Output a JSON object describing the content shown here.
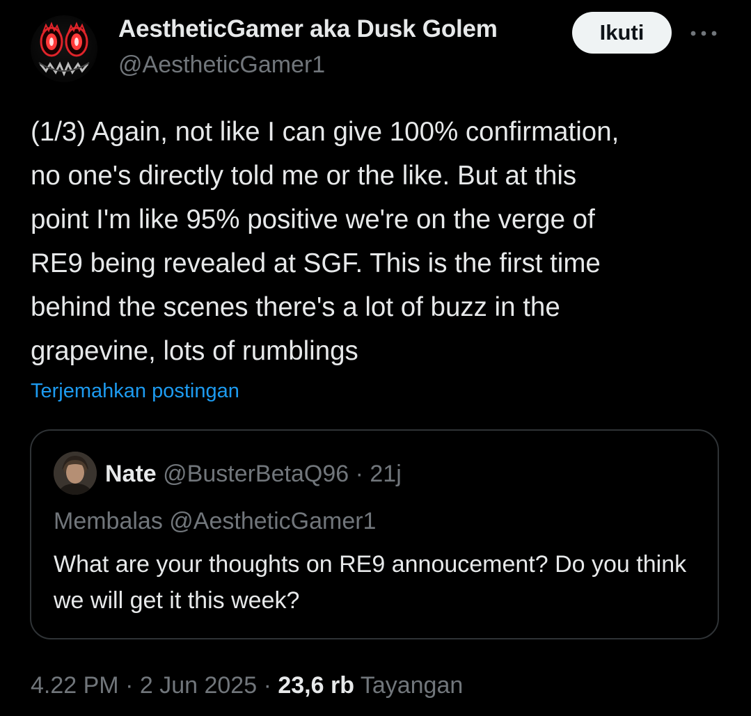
{
  "author": {
    "name": "AestheticGamer aka Dusk Golem",
    "handle": "@AestheticGamer1",
    "avatar_icon": "red-eyed-demon-face-avatar"
  },
  "actions": {
    "follow_label": "Ikuti",
    "more_icon": "more-horizontal-icon"
  },
  "post": {
    "text": "(1/3) Again, not like I can give 100% confirmation,\nno one's directly told me or the like. But at this\npoint I'm like 95% positive we're on the verge of\nRE9 being revealed at SGF. This is the first time\nbehind the scenes there's a lot of buzz in the\ngrapevine, lots of rumblings",
    "translate_label": "Terjemahkan postingan"
  },
  "quote": {
    "name": "Nate",
    "handle": "@BusterBetaQ96",
    "separator": "·",
    "time": "21j",
    "reply_to": "Membalas @AestheticGamer1",
    "text": "What are your thoughts on RE9 annoucement? Do you think we will get it this week?"
  },
  "meta": {
    "time": "4.22 PM",
    "separator": "·",
    "date": "2 Jun 2025",
    "views_count": "23,6 rb",
    "views_label": "Tayangan"
  },
  "colors": {
    "background": "#000000",
    "text_primary": "#e7e9ea",
    "text_secondary": "#71767b",
    "link": "#1d9bf0",
    "border": "#2f3336",
    "follow_bg": "#eff3f4",
    "avatar_eye_red": "#e0242a"
  }
}
